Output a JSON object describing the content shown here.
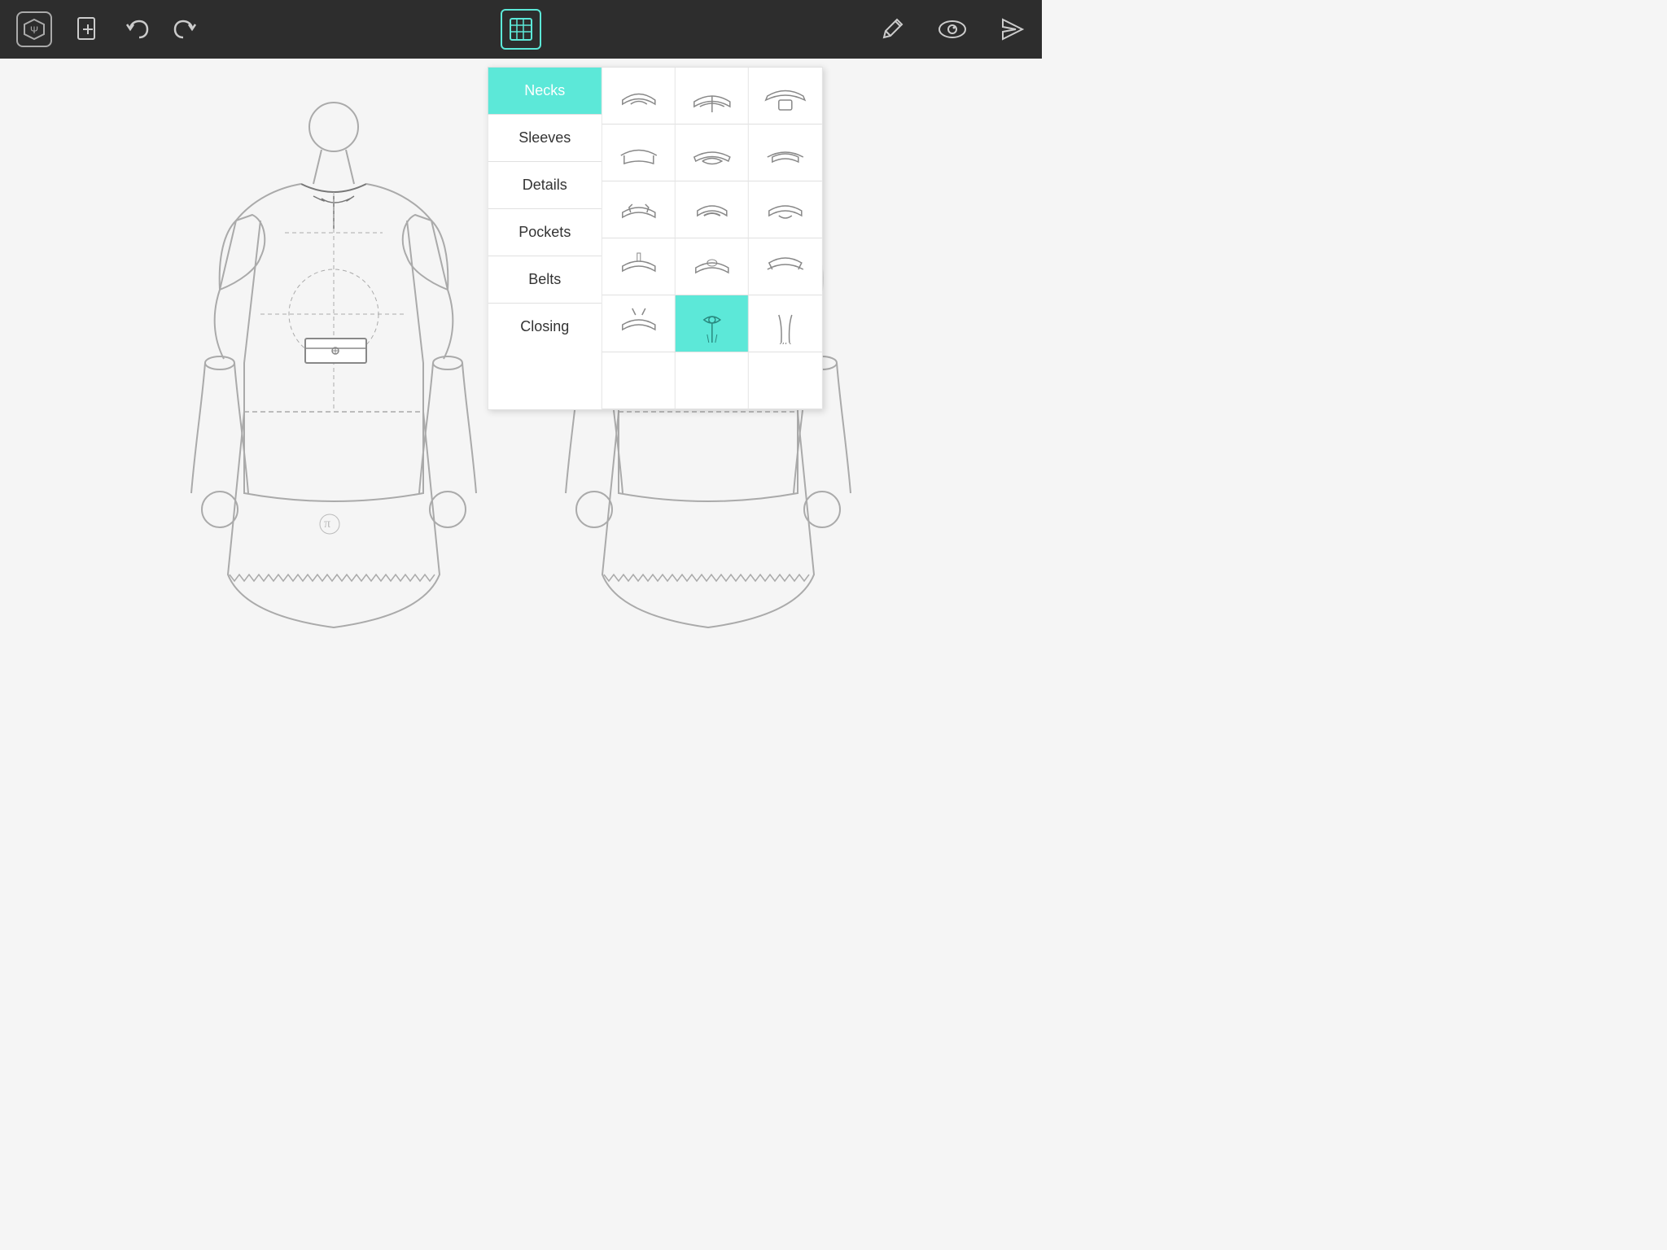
{
  "toolbar": {
    "logo_label": "Ψ",
    "add_label": "+",
    "undo_label": "↩",
    "redo_label": "↪",
    "list_label": "☰",
    "pencil_label": "✎",
    "eye_label": "👁",
    "send_label": "➤"
  },
  "menu": {
    "categories": [
      {
        "id": "necks",
        "label": "Necks",
        "active": true
      },
      {
        "id": "sleeves",
        "label": "Sleeves",
        "active": false
      },
      {
        "id": "details",
        "label": "Details",
        "active": false
      },
      {
        "id": "pockets",
        "label": "Pockets",
        "active": false
      },
      {
        "id": "belts",
        "label": "Belts",
        "active": false
      },
      {
        "id": "closing",
        "label": "Closing",
        "active": false
      }
    ],
    "grid_rows": 6,
    "grid_cols": 3
  },
  "colors": {
    "toolbar_bg": "#2d2d2d",
    "accent": "#5ce8d8",
    "menu_bg": "#ffffff",
    "border": "#e0e0e0",
    "sketch_stroke": "#999999",
    "sketch_dark": "#555555"
  }
}
